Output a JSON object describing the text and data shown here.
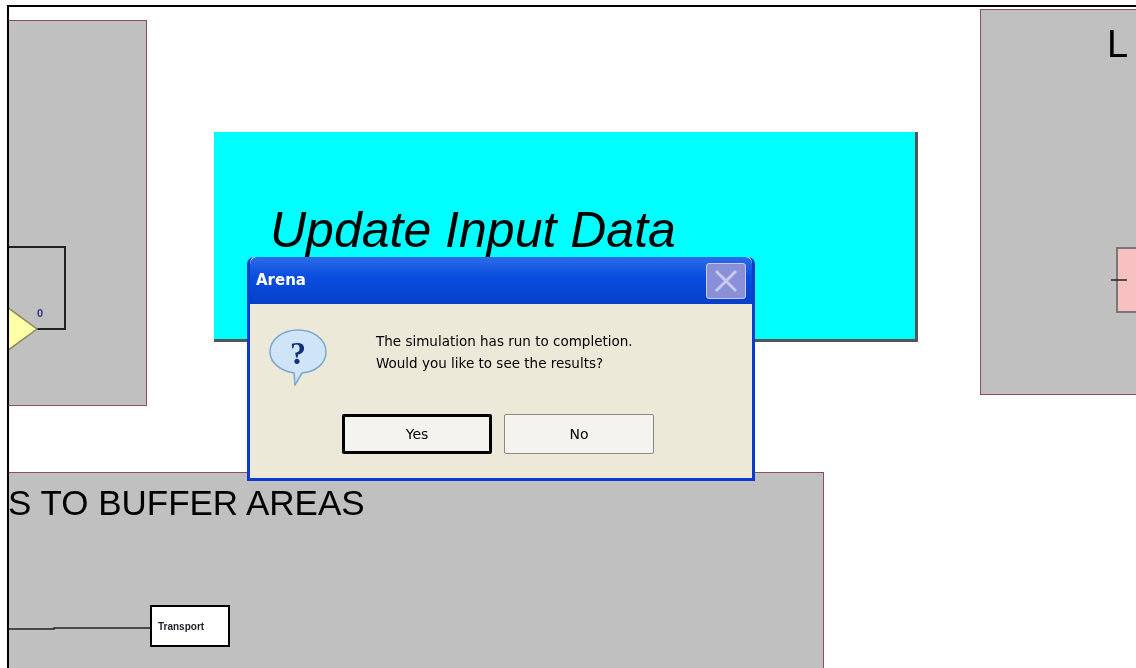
{
  "canvas": {
    "left_panel": {
      "counter": "0"
    },
    "action_button": {
      "label": "Update Input Data"
    },
    "right_panel": {
      "title": "L"
    },
    "bottom_panel": {
      "title": "S TO BUFFER AREAS",
      "module": "Transport"
    }
  },
  "dialog": {
    "title": "Arena",
    "icon": "?",
    "message_lines": [
      "The simulation has run to completion.",
      "Would you like to see the results?"
    ],
    "buttons": [
      {
        "label": "Yes",
        "default": true
      },
      {
        "label": "No",
        "default": false
      }
    ]
  }
}
